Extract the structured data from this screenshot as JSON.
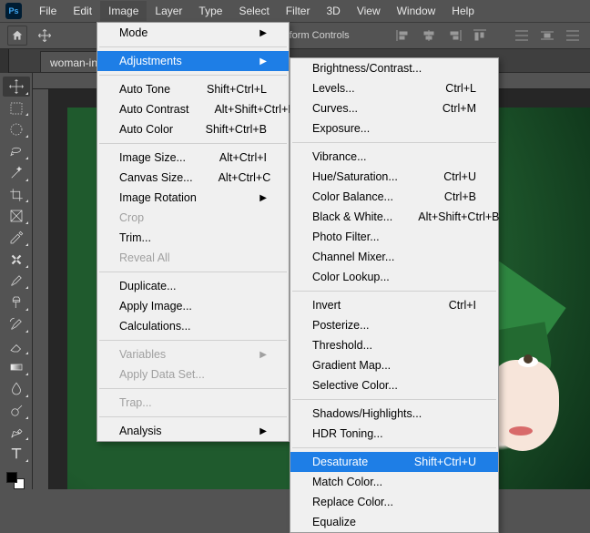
{
  "menubar": {
    "items": [
      "File",
      "Edit",
      "Image",
      "Layer",
      "Type",
      "Select",
      "Filter",
      "3D",
      "View",
      "Window",
      "Help"
    ],
    "active": "Image"
  },
  "options_bar": {
    "transform_label": "nsform Controls"
  },
  "tab": {
    "title": "woman-in-"
  },
  "image_menu": [
    {
      "label": "Mode",
      "submenu": true
    },
    "sep",
    {
      "label": "Adjustments",
      "submenu": true,
      "highlight": true
    },
    "sep",
    {
      "label": "Auto Tone",
      "shortcut": "Shift+Ctrl+L"
    },
    {
      "label": "Auto Contrast",
      "shortcut": "Alt+Shift+Ctrl+L"
    },
    {
      "label": "Auto Color",
      "shortcut": "Shift+Ctrl+B"
    },
    "sep",
    {
      "label": "Image Size...",
      "shortcut": "Alt+Ctrl+I"
    },
    {
      "label": "Canvas Size...",
      "shortcut": "Alt+Ctrl+C"
    },
    {
      "label": "Image Rotation",
      "submenu": true
    },
    {
      "label": "Crop",
      "disabled": true
    },
    {
      "label": "Trim..."
    },
    {
      "label": "Reveal All",
      "disabled": true
    },
    "sep",
    {
      "label": "Duplicate..."
    },
    {
      "label": "Apply Image..."
    },
    {
      "label": "Calculations..."
    },
    "sep",
    {
      "label": "Variables",
      "submenu": true,
      "disabled": true
    },
    {
      "label": "Apply Data Set...",
      "disabled": true
    },
    "sep",
    {
      "label": "Trap...",
      "disabled": true
    },
    "sep",
    {
      "label": "Analysis",
      "submenu": true
    }
  ],
  "adjust_menu": [
    {
      "label": "Brightness/Contrast..."
    },
    {
      "label": "Levels...",
      "shortcut": "Ctrl+L"
    },
    {
      "label": "Curves...",
      "shortcut": "Ctrl+M"
    },
    {
      "label": "Exposure..."
    },
    "sep",
    {
      "label": "Vibrance..."
    },
    {
      "label": "Hue/Saturation...",
      "shortcut": "Ctrl+U"
    },
    {
      "label": "Color Balance...",
      "shortcut": "Ctrl+B"
    },
    {
      "label": "Black & White...",
      "shortcut": "Alt+Shift+Ctrl+B"
    },
    {
      "label": "Photo Filter..."
    },
    {
      "label": "Channel Mixer..."
    },
    {
      "label": "Color Lookup..."
    },
    "sep",
    {
      "label": "Invert",
      "shortcut": "Ctrl+I"
    },
    {
      "label": "Posterize..."
    },
    {
      "label": "Threshold..."
    },
    {
      "label": "Gradient Map..."
    },
    {
      "label": "Selective Color..."
    },
    "sep",
    {
      "label": "Shadows/Highlights..."
    },
    {
      "label": "HDR Toning..."
    },
    "sep",
    {
      "label": "Desaturate",
      "shortcut": "Shift+Ctrl+U",
      "highlight": true
    },
    {
      "label": "Match Color..."
    },
    {
      "label": "Replace Color..."
    },
    {
      "label": "Equalize"
    }
  ],
  "tools": [
    "move",
    "marquee",
    "ellipse-marquee",
    "lasso",
    "magic-wand",
    "crop",
    "frame",
    "eyedropper",
    "healing",
    "brush",
    "clone",
    "history-brush",
    "eraser",
    "gradient",
    "blur",
    "dodge",
    "pen",
    "type"
  ]
}
